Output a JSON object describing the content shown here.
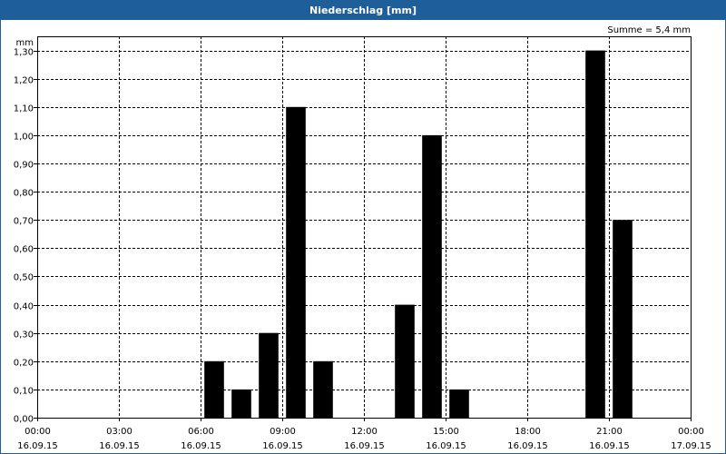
{
  "window": {
    "title": "Niederschlag [mm]"
  },
  "colors": {
    "titlebar": "#1f5f99",
    "bar": "#000000",
    "grid": "#000000"
  },
  "chart_data": {
    "type": "bar",
    "title": "Niederschlag [mm]",
    "ylabel": "mm",
    "annotation": "Summe = 5,4 mm",
    "ylim": [
      0,
      1.35
    ],
    "grid": true,
    "y_ticks": [
      "0,00",
      "0,10",
      "0,20",
      "0,30",
      "0,40",
      "0,50",
      "0,60",
      "0,70",
      "0,80",
      "0,90",
      "1,00",
      "1,10",
      "1,20",
      "1,30"
    ],
    "y_tick_values": [
      0,
      0.1,
      0.2,
      0.3,
      0.4,
      0.5,
      0.6,
      0.7,
      0.8,
      0.9,
      1.0,
      1.1,
      1.2,
      1.3
    ],
    "x_ticks": [
      {
        "hour": 0,
        "time": "00:00",
        "date": "16.09.15"
      },
      {
        "hour": 3,
        "time": "03:00",
        "date": "16.09.15"
      },
      {
        "hour": 6,
        "time": "06:00",
        "date": "16.09.15"
      },
      {
        "hour": 9,
        "time": "09:00",
        "date": "16.09.15"
      },
      {
        "hour": 12,
        "time": "12:00",
        "date": "16.09.15"
      },
      {
        "hour": 15,
        "time": "15:00",
        "date": "16.09.15"
      },
      {
        "hour": 18,
        "time": "18:00",
        "date": "16.09.15"
      },
      {
        "hour": 21,
        "time": "21:00",
        "date": "16.09.15"
      },
      {
        "hour": 24,
        "time": "00:00",
        "date": "17.09.15"
      }
    ],
    "xlim_hours": [
      0,
      24
    ],
    "bars": [
      {
        "hour": 7,
        "value": 0.2
      },
      {
        "hour": 8,
        "value": 0.1
      },
      {
        "hour": 9,
        "value": 0.3
      },
      {
        "hour": 10,
        "value": 1.1
      },
      {
        "hour": 11,
        "value": 0.2
      },
      {
        "hour": 14,
        "value": 0.4
      },
      {
        "hour": 15,
        "value": 1.0
      },
      {
        "hour": 16,
        "value": 0.1
      },
      {
        "hour": 21,
        "value": 1.3
      },
      {
        "hour": 22,
        "value": 0.7
      }
    ]
  }
}
